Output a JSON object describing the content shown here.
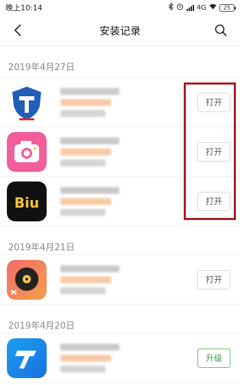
{
  "status_bar": {
    "time": "晚上10:14",
    "network": "4G",
    "battery": "25"
  },
  "nav": {
    "title": "安装记录"
  },
  "groups": [
    {
      "date": "2019年4月27日",
      "apps": [
        {
          "icon": "shield-t-app-icon",
          "button": "打开"
        },
        {
          "icon": "camera-app-icon",
          "button": "打开"
        },
        {
          "icon": "biu-app-icon",
          "icon_text": "Biu",
          "button": "打开"
        }
      ]
    },
    {
      "date": "2019年4月21日",
      "apps": [
        {
          "icon": "music-disc-app-icon",
          "button": "打开"
        }
      ]
    },
    {
      "date": "2019年4月20日",
      "apps": [
        {
          "icon": "blue-t-app-icon",
          "button": "升级"
        }
      ]
    }
  ],
  "colors": {
    "accent_upgrade": "#3a9c45",
    "highlight": "#a8191c"
  }
}
